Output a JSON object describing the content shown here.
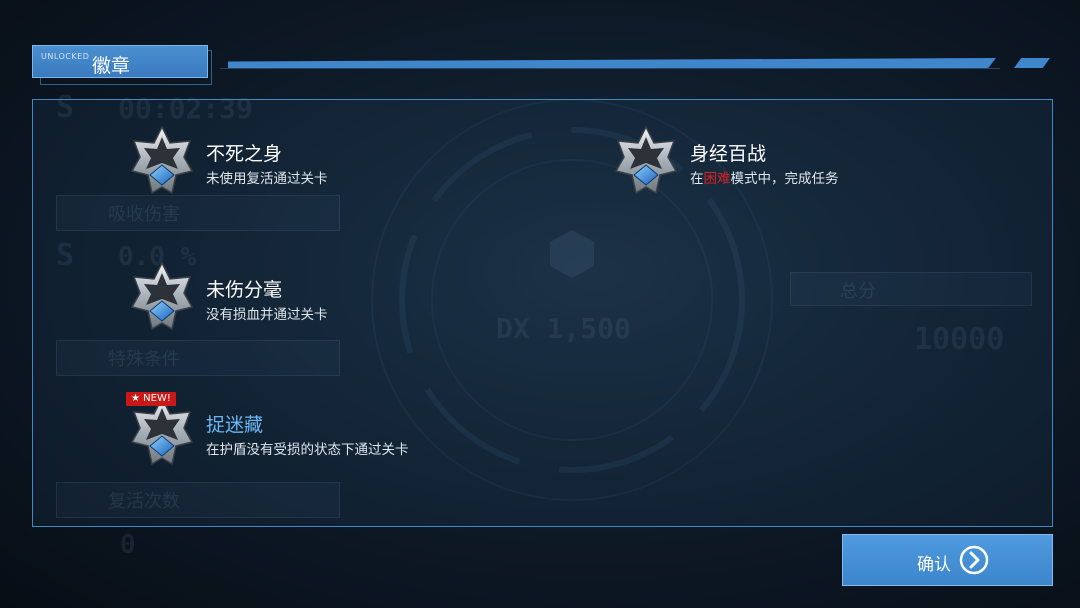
{
  "header": {
    "tag": "UNLOCKED",
    "title": "徽章"
  },
  "background": {
    "timer": "00:02:39",
    "grade_1": "S",
    "grade_2": "S",
    "percent": "0.0 %",
    "label_1": "吸收伤害",
    "label_2": "特殊条件",
    "label_3": "复活次数",
    "revive_count": "0",
    "center_value": "DX 1,500",
    "score_label": "总分",
    "score_value": "10000"
  },
  "achievements": [
    {
      "name": "不死之身",
      "desc": "未使用复活通过关卡",
      "is_new": false,
      "icon": "silver-star-medal-icon"
    },
    {
      "name": "身经百战",
      "desc_prefix": "在",
      "desc_highlight": "困难",
      "desc_suffix": "模式中，完成任务",
      "highlight_color": "#e02020",
      "is_new": false,
      "icon": "silver-star-medal-icon"
    },
    {
      "name": "未伤分毫",
      "desc": "没有损血并通过关卡",
      "is_new": false,
      "icon": "silver-star-medal-icon"
    },
    {
      "name": "捉迷藏",
      "desc": "在护盾没有受损的状态下通过关卡",
      "is_new": true,
      "badge": "★ NEW!",
      "name_color": "#6bb5f2",
      "icon": "silver-star-medal-icon"
    }
  ],
  "confirm": {
    "label": "确认",
    "icon": "chevron-right-circle-icon"
  },
  "colors": {
    "accent": "#3f86cc",
    "panel_border": "#3d8ac7",
    "new_badge": "#c81818"
  }
}
